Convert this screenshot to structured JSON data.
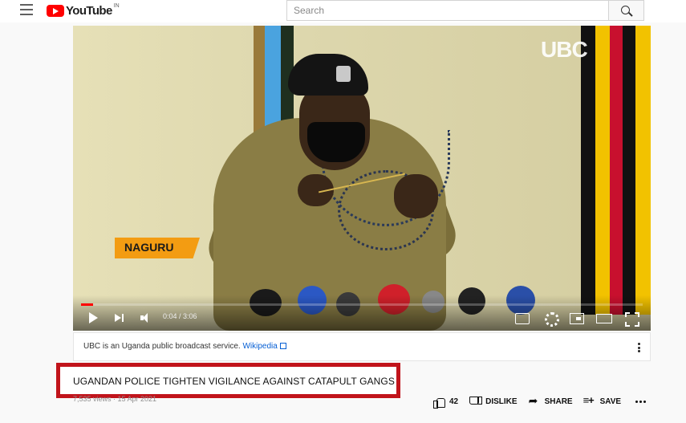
{
  "header": {
    "logo_text": "YouTube",
    "logo_region": "IN",
    "search_placeholder": "Search"
  },
  "player": {
    "overlay_brand": "UBC",
    "location_tag": "NAGURU",
    "time": "0:04 / 3:06",
    "progress_fraction": 0.022
  },
  "info_panel": {
    "text": "UBC is an Uganda public broadcast service.",
    "link": "Wikipedia"
  },
  "video": {
    "title": "UGANDAN POLICE TIGHTEN VIGILANCE AGAINST CATAPULT GANGS",
    "meta": "7,535 views · 15 Apr 2021"
  },
  "actions": {
    "likes": "42",
    "dislike": "DISLIKE",
    "share": "SHARE",
    "save": "SAVE"
  },
  "colors": {
    "brand_red": "#ff0000",
    "highlight_border": "#c1141b",
    "link": "#065fd4"
  }
}
